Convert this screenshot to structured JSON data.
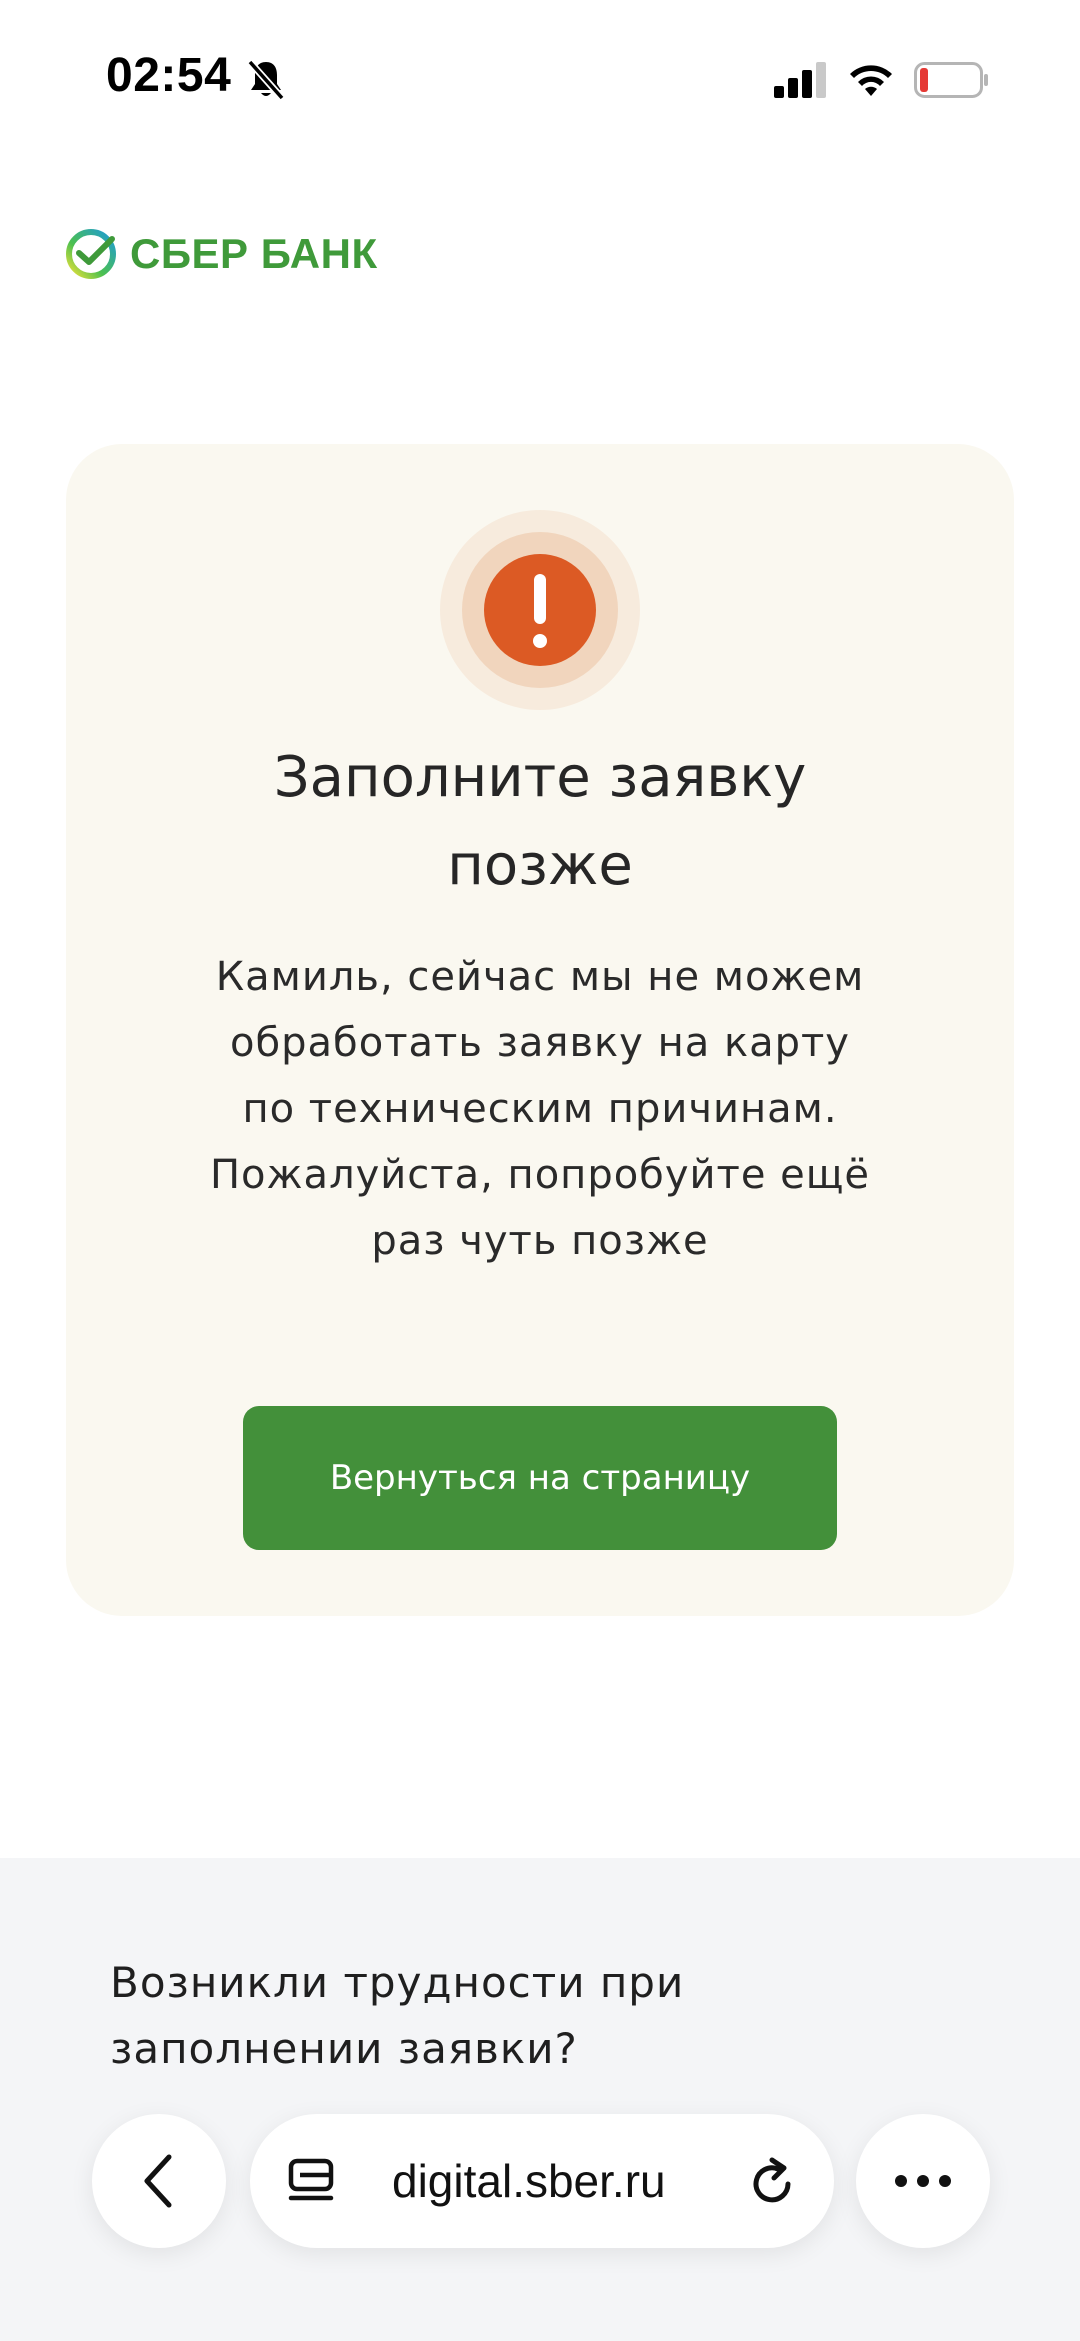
{
  "status_bar": {
    "time": "02:54",
    "battery_color": "#e53935"
  },
  "brand": {
    "name": "СБЕР БАНК",
    "color": "#3f9a3a"
  },
  "error_card": {
    "icon": "exclamation-icon",
    "icon_color": "#dc5a24",
    "title": "Заполните заявку позже",
    "message": "Камиль, сейчас мы не можем обработать заявку на карту по техническим причинам. Пожалуйста, попробуйте ещё раз чуть позже",
    "button_label": "Вернуться на страницу",
    "button_color": "#43903a"
  },
  "help": {
    "text": "Возникли трудности при заполнении заявки?"
  },
  "browser": {
    "url": "digital.sber.ru"
  }
}
